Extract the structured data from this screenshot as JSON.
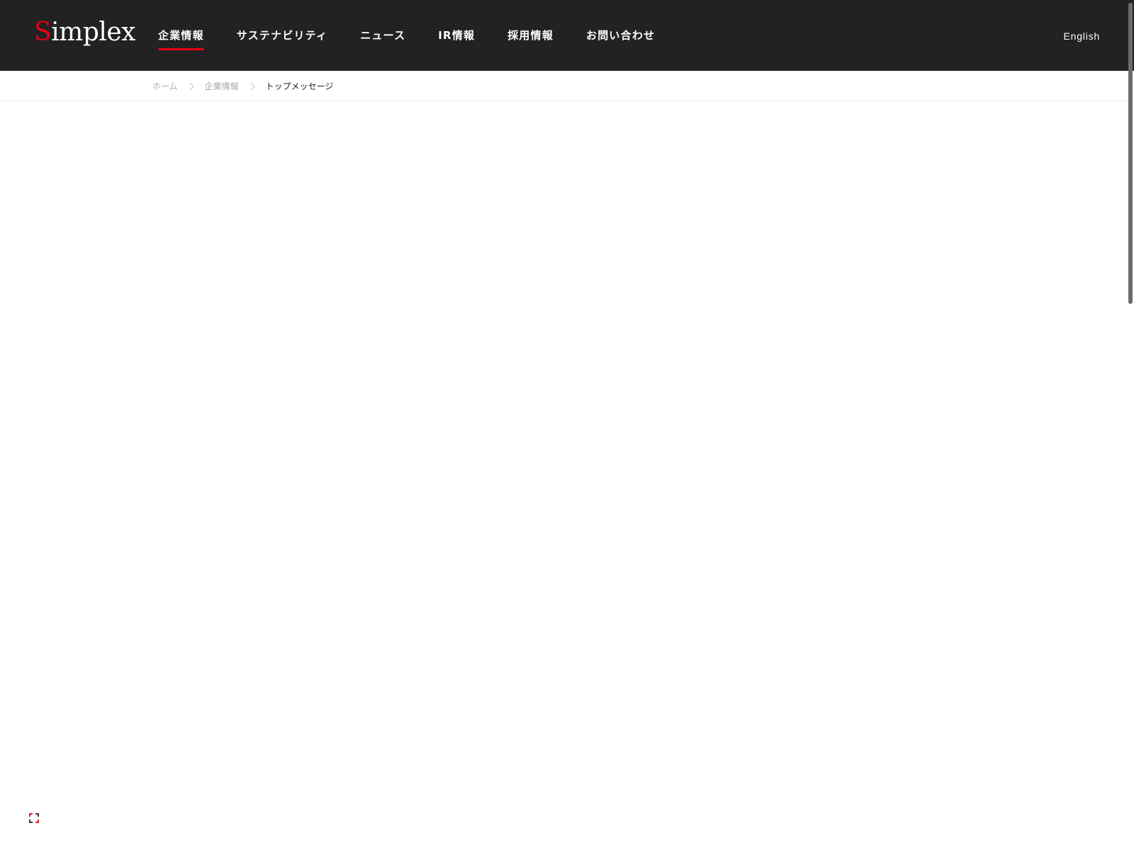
{
  "header": {
    "logo": {
      "first_letter": "S",
      "rest": "implex"
    },
    "nav": [
      {
        "label": "企業情報",
        "active": true
      },
      {
        "label": "サステナビリティ",
        "active": false
      },
      {
        "label": "ニュース",
        "active": false
      },
      {
        "label": "IR情報",
        "active": false
      },
      {
        "label": "採用情報",
        "active": false
      },
      {
        "label": "お問い合わせ",
        "active": false
      }
    ],
    "language": "English"
  },
  "breadcrumb": {
    "items": [
      "ホーム",
      "企業情報",
      "トップメッセージ"
    ]
  },
  "colors": {
    "header_bg": "#222222",
    "accent": "#e60012",
    "breadcrumb_inactive": "#a8a8a8",
    "breadcrumb_active": "#222222"
  },
  "icons": {
    "separator": "chevron-right-icon",
    "loader": "loading-spinner-icon"
  }
}
